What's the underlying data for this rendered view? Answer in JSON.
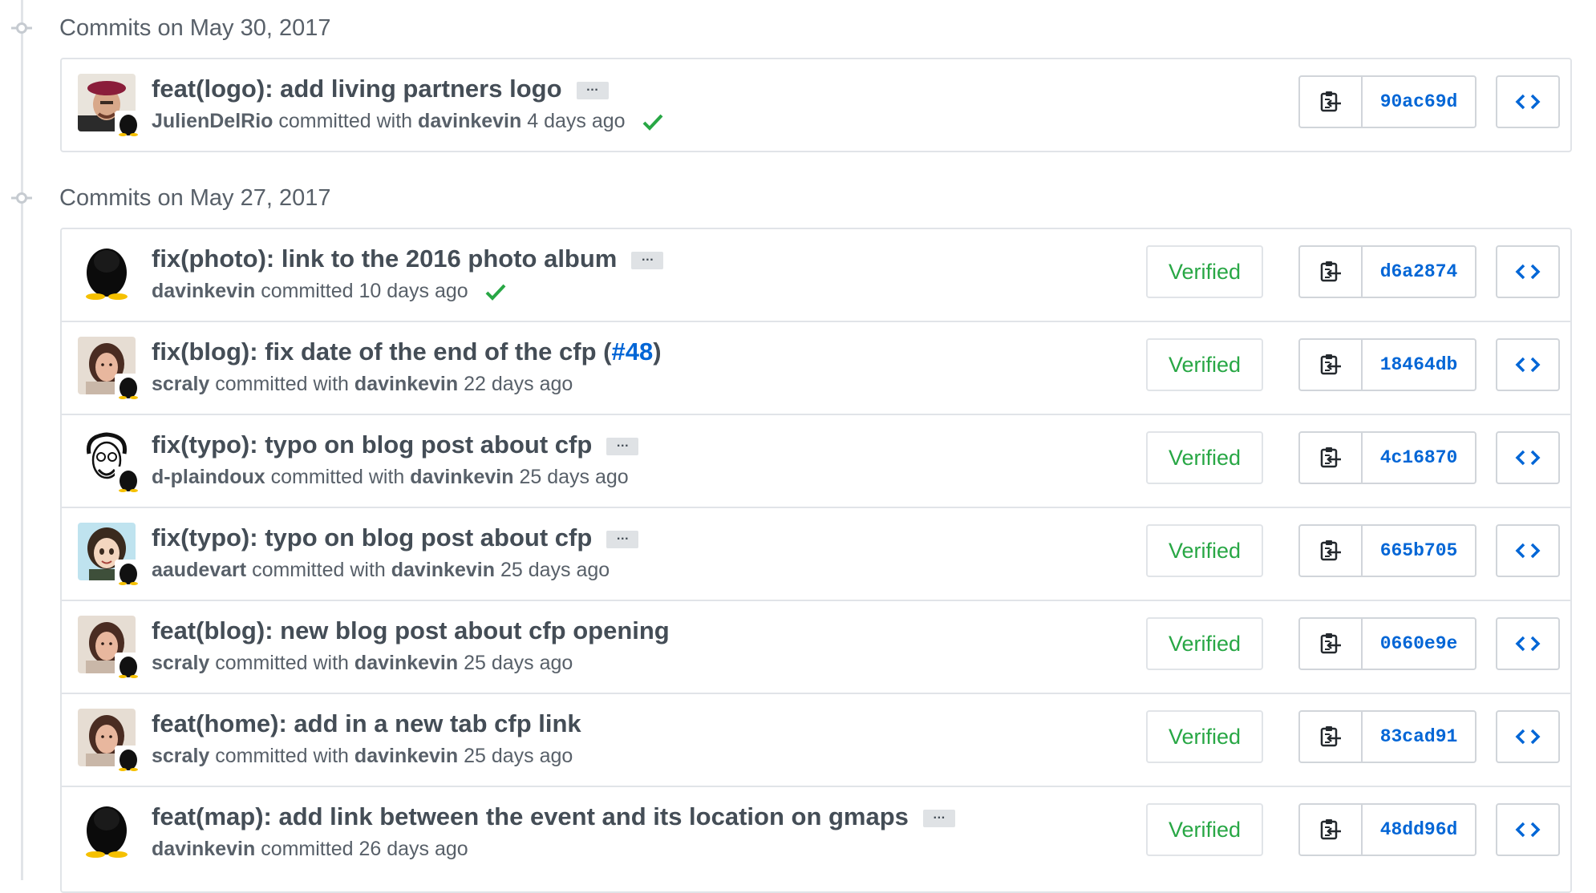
{
  "groups": [
    {
      "date_label": "Commits on May 30, 2017",
      "commits": [
        {
          "message": "feat(logo): add living partners logo",
          "author": "JulienDelRio",
          "connector": "committed with",
          "committer": "davinkevin",
          "time": "4 days ago",
          "status": "success",
          "sha": "90ac69d",
          "avatar": "beret-avatar"
        }
      ]
    },
    {
      "date_label": "Commits on May 27, 2017",
      "commits": [
        {
          "message": "fix(photo): link to the 2016 photo album",
          "author": "davinkevin",
          "connector": "committed",
          "time": "10 days ago",
          "status": "success",
          "verified": "Verified",
          "sha": "d6a2874",
          "avatar": "penguin-avatar"
        },
        {
          "message_prefix": "fix(blog): fix date of the end of the cfp (",
          "message_link": "#48",
          "message_suffix": ")",
          "author": "scraly",
          "connector": "committed with",
          "committer": "davinkevin",
          "time": "22 days ago",
          "verified": "Verified",
          "sha": "18464db",
          "avatar": "woman-avatar"
        },
        {
          "message": "fix(typo): typo on blog post about cfp",
          "author": "d-plaindoux",
          "connector": "committed with",
          "committer": "davinkevin",
          "time": "25 days ago",
          "verified": "Verified",
          "sha": "4c16870",
          "avatar": "sketch-avatar"
        },
        {
          "message": "fix(typo): typo on blog post about cfp",
          "author": "aaudevart",
          "connector": "committed with",
          "committer": "davinkevin",
          "time": "25 days ago",
          "verified": "Verified",
          "sha": "665b705",
          "avatar": "cartoon-avatar"
        },
        {
          "message": "feat(blog): new blog post about cfp opening",
          "author": "scraly",
          "connector": "committed with",
          "committer": "davinkevin",
          "time": "25 days ago",
          "verified": "Verified",
          "sha": "0660e9e",
          "avatar": "woman-avatar"
        },
        {
          "message": "feat(home): add in a new tab cfp link",
          "author": "scraly",
          "connector": "committed with",
          "committer": "davinkevin",
          "time": "25 days ago",
          "verified": "Verified",
          "sha": "83cad91",
          "avatar": "woman-avatar"
        },
        {
          "message": "feat(map): add link between the event and its location on gmaps",
          "author": "davinkevin",
          "connector": "committed",
          "time": "26 days ago",
          "verified": "Verified",
          "sha": "48dd96d",
          "avatar": "penguin-avatar"
        }
      ]
    }
  ],
  "ui": {
    "ellipsis_label": "…",
    "copy_icon": "clippy-icon",
    "browse_icon": "code-icon",
    "colors": {
      "link": "#0366d6",
      "verified": "#28a745",
      "border": "#e1e4e8",
      "muted": "#586069"
    }
  }
}
